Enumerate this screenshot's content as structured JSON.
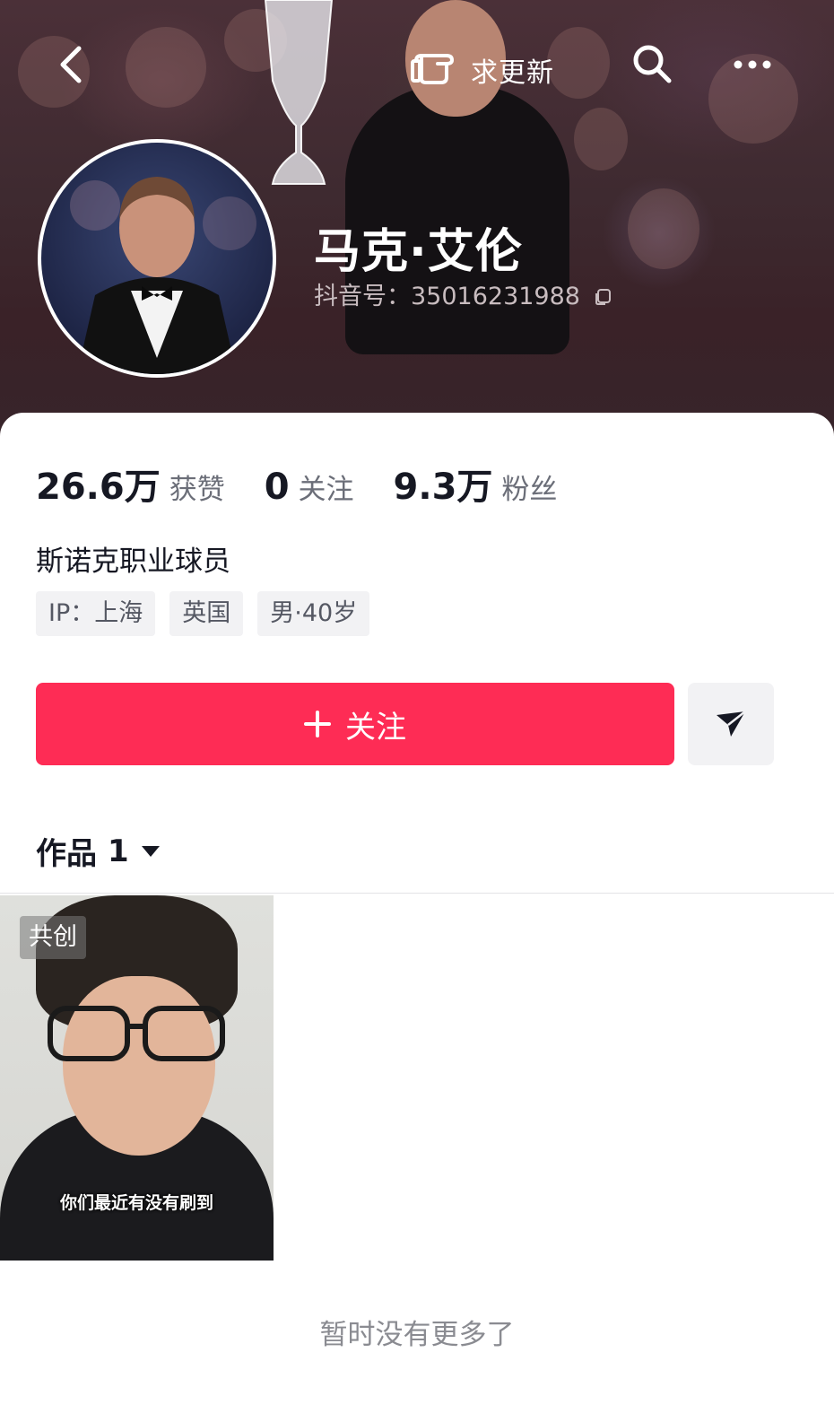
{
  "header": {
    "update_request_label": "求更新",
    "display_name": "马克·艾伦",
    "douyin_id": "抖音号：35016231988"
  },
  "stats": {
    "likes_count": "26.6万",
    "likes_label": "获赞",
    "following_count": "0",
    "following_label": "关注",
    "followers_count": "9.3万",
    "followers_label": "粉丝"
  },
  "profile": {
    "bio": "斯诺克职业球员",
    "tags": [
      "IP：上海",
      "英国",
      "男·40岁"
    ]
  },
  "actions": {
    "follow_label": "关注"
  },
  "works": {
    "tab_label": "作品",
    "count": "1",
    "items": [
      {
        "badge": "共创",
        "caption": "你们最近有没有刷到"
      }
    ]
  },
  "footer": {
    "end_text": "暂时没有更多了"
  },
  "colors": {
    "accent": "#fe2c55",
    "banner": "#3e2a30",
    "text_primary": "#161823",
    "text_secondary": "#6b6e78"
  },
  "icons": [
    "back-icon",
    "hand-point-icon",
    "search-icon",
    "more-icon",
    "copy-icon",
    "plus-icon",
    "share-icon",
    "caret-down-icon"
  ]
}
